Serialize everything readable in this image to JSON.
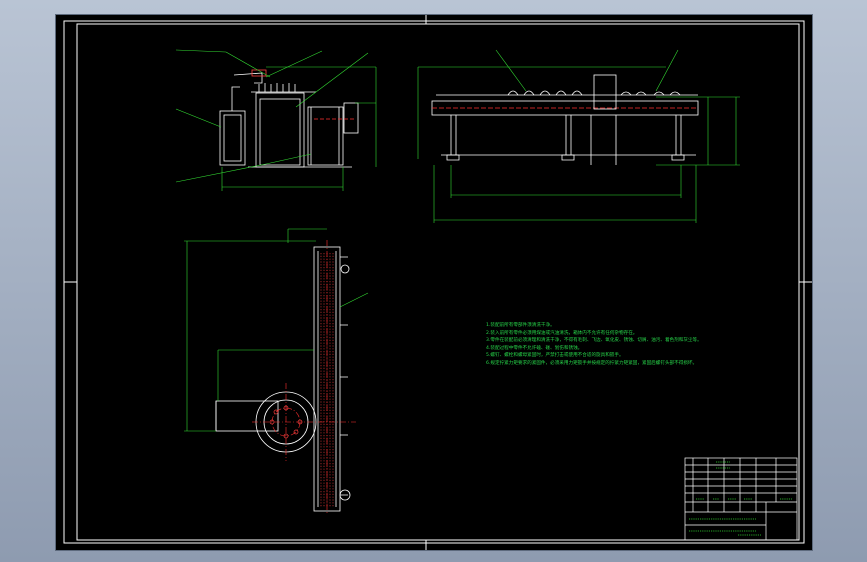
{
  "drawing": {
    "technical_notes": [
      "1.装配前所有零部件须清洗干净。",
      "2.装入前所有零件必须用煤油或汽油清洗，箱体内不允许有任何杂物存在。",
      "3.零件在装配前必须清理和清洗干净，不得有毛刺、飞边、氧化皮、锈蚀、切屑、油污、着色剂和灰尘等。",
      "4.装配过程中零件不允许磕、碰、划伤和锈蚀。",
      "5.螺钉、螺栓和螺母紧固时，严禁打击或使用不合适的旋具和扳手。",
      "6.规定拧紧力矩要求的紧固件，必须采用力矩扳手并按规定的拧紧力矩紧固，紧固后螺钉头部不得损坏。"
    ],
    "colors": {
      "background": "#000000",
      "frame": "#ffffff",
      "outline": "#ffffff",
      "dimension": "#33dd33",
      "centerline": "#ff3030",
      "notes_text": "#27d64a"
    }
  }
}
